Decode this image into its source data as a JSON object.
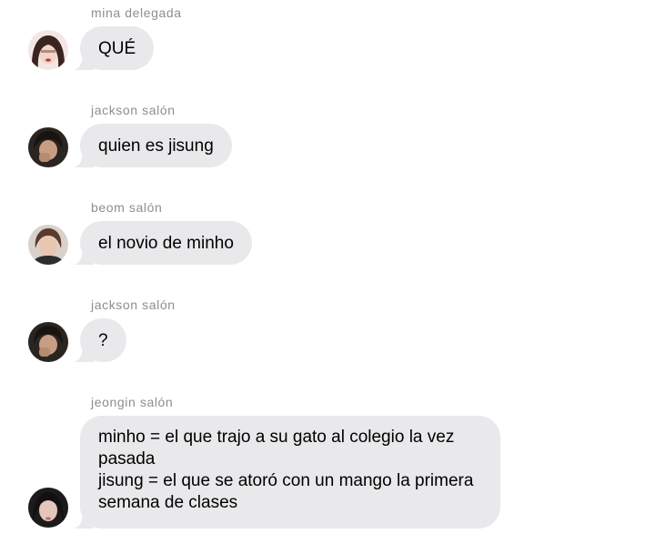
{
  "messages": [
    {
      "sender": "mina delegada",
      "text": "QUÉ",
      "avatar": "avatar-mina"
    },
    {
      "sender": "jackson salón",
      "text": "quien es jisung",
      "avatar": "avatar-jackson"
    },
    {
      "sender": "beom salón",
      "text": "el novio de minho",
      "avatar": "avatar-beom"
    },
    {
      "sender": "jackson salón",
      "text": "?",
      "avatar": "avatar-jackson"
    },
    {
      "sender": "jeongin salón",
      "lines": [
        "minho = el que trajo a su gato al colegio la vez",
        "pasada",
        "jisung = el que se atoró con un mango la primera",
        "semana de clases"
      ],
      "avatar": "avatar-jeongin"
    }
  ],
  "colors": {
    "bubble": "#e9e9eb",
    "sender_text": "#8e8e93",
    "message_text": "#000000"
  }
}
